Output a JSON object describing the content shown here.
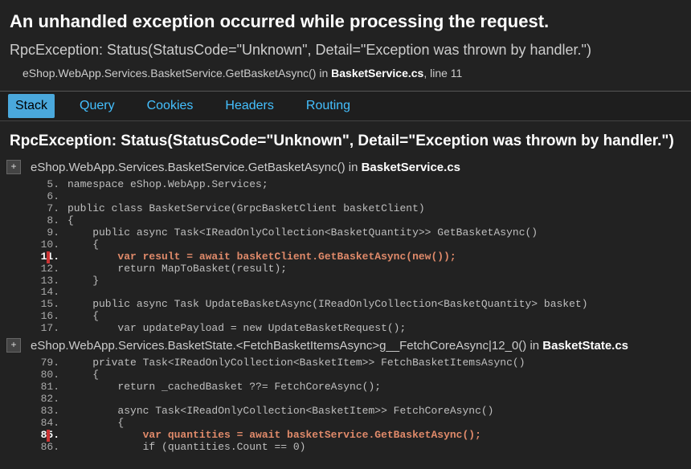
{
  "title": "An unhandled exception occurred while processing the request.",
  "exception_line": "RpcException: Status(StatusCode=\"Unknown\", Detail=\"Exception was thrown by handler.\")",
  "summary": {
    "method": "eShop.WebApp.Services.BasketService.GetBasketAsync() in ",
    "file": "BasketService.cs",
    "line_text": ", line 11"
  },
  "tabs": [
    {
      "label": "Stack",
      "active": true
    },
    {
      "label": "Query",
      "active": false
    },
    {
      "label": "Cookies",
      "active": false
    },
    {
      "label": "Headers",
      "active": false
    },
    {
      "label": "Routing",
      "active": false
    }
  ],
  "stack_heading": "RpcException: Status(StatusCode=\"Unknown\", Detail=\"Exception was thrown by handler.\")",
  "frames": [
    {
      "method": "eShop.WebApp.Services.BasketService.GetBasketAsync() in ",
      "file": "BasketService.cs",
      "highlight_line": 11,
      "code": [
        {
          "n": 5,
          "src": "namespace eShop.WebApp.Services;"
        },
        {
          "n": 6,
          "src": ""
        },
        {
          "n": 7,
          "src": "public class BasketService(GrpcBasketClient basketClient)"
        },
        {
          "n": 8,
          "src": "{"
        },
        {
          "n": 9,
          "src": "    public async Task<IReadOnlyCollection<BasketQuantity>> GetBasketAsync()"
        },
        {
          "n": 10,
          "src": "    {"
        },
        {
          "n": 11,
          "src": "        var result = await basketClient.GetBasketAsync(new());"
        },
        {
          "n": 12,
          "src": "        return MapToBasket(result);"
        },
        {
          "n": 13,
          "src": "    }"
        },
        {
          "n": 14,
          "src": ""
        },
        {
          "n": 15,
          "src": "    public async Task UpdateBasketAsync(IReadOnlyCollection<BasketQuantity> basket)"
        },
        {
          "n": 16,
          "src": "    {"
        },
        {
          "n": 17,
          "src": "        var updatePayload = new UpdateBasketRequest();"
        }
      ]
    },
    {
      "method": "eShop.WebApp.Services.BasketState.<FetchBasketItemsAsync>g__FetchCoreAsync|12_0() in ",
      "file": "BasketState.cs",
      "highlight_line": 85,
      "code": [
        {
          "n": 79,
          "src": "    private Task<IReadOnlyCollection<BasketItem>> FetchBasketItemsAsync()"
        },
        {
          "n": 80,
          "src": "    {"
        },
        {
          "n": 81,
          "src": "        return _cachedBasket ??= FetchCoreAsync();"
        },
        {
          "n": 82,
          "src": ""
        },
        {
          "n": 83,
          "src": "        async Task<IReadOnlyCollection<BasketItem>> FetchCoreAsync()"
        },
        {
          "n": 84,
          "src": "        {"
        },
        {
          "n": 85,
          "src": "            var quantities = await basketService.GetBasketAsync();"
        },
        {
          "n": 86,
          "src": "            if (quantities.Count == 0)"
        }
      ]
    }
  ]
}
